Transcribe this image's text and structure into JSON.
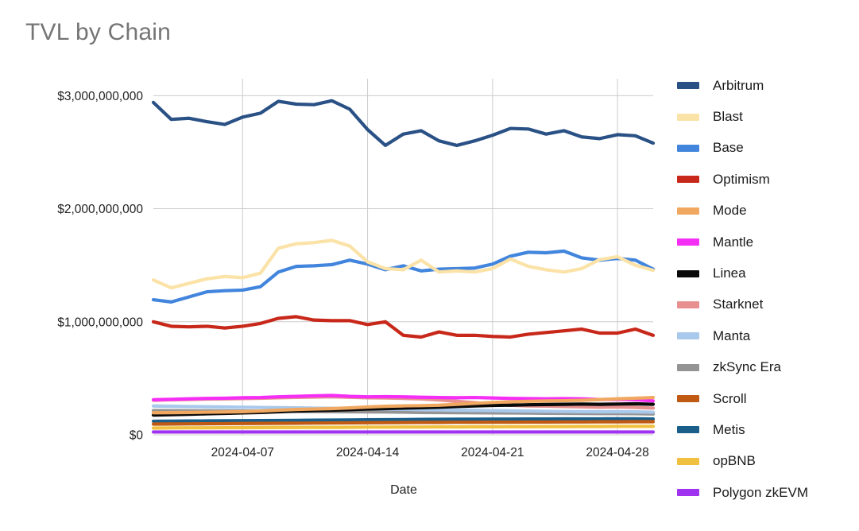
{
  "chart_data": {
    "type": "line",
    "title": "TVL by Chain",
    "xlabel": "Date",
    "ylabel": "",
    "grid": true,
    "legend_position": "right",
    "ylim": [
      0,
      3150000000
    ],
    "y_ticks": [
      0,
      1000000000,
      2000000000,
      3000000000
    ],
    "y_tick_labels": [
      "$0",
      "$1,000,000,000",
      "$2,000,000,000",
      "$3,000,000,000"
    ],
    "x_tick_labels": [
      "2024-04-07",
      "2024-04-14",
      "2024-04-21",
      "2024-04-28"
    ],
    "x_tick_indices": [
      5,
      12,
      19,
      26
    ],
    "x": [
      "2024-04-02",
      "2024-04-03",
      "2024-04-04",
      "2024-04-05",
      "2024-04-06",
      "2024-04-07",
      "2024-04-08",
      "2024-04-09",
      "2024-04-10",
      "2024-04-11",
      "2024-04-12",
      "2024-04-13",
      "2024-04-14",
      "2024-04-15",
      "2024-04-16",
      "2024-04-17",
      "2024-04-18",
      "2024-04-19",
      "2024-04-20",
      "2024-04-21",
      "2024-04-22",
      "2024-04-23",
      "2024-04-24",
      "2024-04-25",
      "2024-04-26",
      "2024-04-27",
      "2024-04-28",
      "2024-04-29",
      "2024-04-30"
    ],
    "series": [
      {
        "name": "Arbitrum",
        "color": "#2a5185",
        "values": [
          2940000000,
          2790000000,
          2800000000,
          2770000000,
          2745000000,
          2810000000,
          2845000000,
          2950000000,
          2925000000,
          2920000000,
          2955000000,
          2880000000,
          2700000000,
          2560000000,
          2660000000,
          2690000000,
          2600000000,
          2560000000,
          2600000000,
          2650000000,
          2710000000,
          2705000000,
          2660000000,
          2690000000,
          2635000000,
          2620000000,
          2655000000,
          2645000000,
          2580000000
        ]
      },
      {
        "name": "Blast",
        "color": "#fbe2a7",
        "values": [
          1370000000,
          1300000000,
          1340000000,
          1380000000,
          1400000000,
          1390000000,
          1430000000,
          1650000000,
          1690000000,
          1700000000,
          1720000000,
          1670000000,
          1530000000,
          1470000000,
          1460000000,
          1545000000,
          1440000000,
          1450000000,
          1440000000,
          1470000000,
          1555000000,
          1490000000,
          1460000000,
          1440000000,
          1470000000,
          1550000000,
          1575000000,
          1500000000,
          1455000000
        ]
      },
      {
        "name": "Base",
        "color": "#4285dd",
        "values": [
          1195000000,
          1175000000,
          1220000000,
          1265000000,
          1275000000,
          1280000000,
          1310000000,
          1440000000,
          1490000000,
          1495000000,
          1505000000,
          1545000000,
          1510000000,
          1460000000,
          1495000000,
          1450000000,
          1465000000,
          1470000000,
          1475000000,
          1510000000,
          1580000000,
          1615000000,
          1610000000,
          1625000000,
          1565000000,
          1545000000,
          1560000000,
          1545000000,
          1465000000
        ]
      },
      {
        "name": "Optimism",
        "color": "#c8281a",
        "values": [
          1000000000,
          960000000,
          955000000,
          960000000,
          945000000,
          960000000,
          985000000,
          1030000000,
          1045000000,
          1015000000,
          1010000000,
          1010000000,
          975000000,
          1000000000,
          880000000,
          865000000,
          910000000,
          880000000,
          880000000,
          870000000,
          865000000,
          890000000,
          905000000,
          920000000,
          935000000,
          900000000,
          900000000,
          935000000,
          880000000
        ]
      },
      {
        "name": "Mode",
        "color": "#f0a860",
        "values": [
          195000000,
          196000000,
          198000000,
          200000000,
          202000000,
          205000000,
          210000000,
          218000000,
          224000000,
          228000000,
          232000000,
          238000000,
          246000000,
          252000000,
          256000000,
          258000000,
          262000000,
          270000000,
          278000000,
          286000000,
          292000000,
          296000000,
          300000000,
          302000000,
          306000000,
          312000000,
          318000000,
          324000000,
          330000000
        ]
      },
      {
        "name": "Mantle",
        "color": "#f52ef5",
        "values": [
          310000000,
          314000000,
          318000000,
          322000000,
          324000000,
          328000000,
          330000000,
          336000000,
          340000000,
          345000000,
          348000000,
          340000000,
          336000000,
          338000000,
          336000000,
          332000000,
          330000000,
          328000000,
          330000000,
          326000000,
          322000000,
          320000000,
          318000000,
          320000000,
          318000000,
          312000000,
          314000000,
          310000000,
          300000000
        ]
      },
      {
        "name": "Linea",
        "color": "#0a0a0a",
        "values": [
          175000000,
          178000000,
          182000000,
          186000000,
          190000000,
          194000000,
          198000000,
          204000000,
          210000000,
          214000000,
          218000000,
          222000000,
          228000000,
          232000000,
          236000000,
          240000000,
          244000000,
          250000000,
          256000000,
          260000000,
          262000000,
          266000000,
          268000000,
          270000000,
          272000000,
          270000000,
          272000000,
          274000000,
          270000000
        ]
      },
      {
        "name": "Starknet",
        "color": "#e89090",
        "values": [
          306000000,
          310000000,
          313000000,
          316000000,
          318000000,
          321000000,
          323000000,
          328000000,
          331000000,
          334000000,
          336000000,
          332000000,
          328000000,
          326000000,
          322000000,
          318000000,
          308000000,
          296000000,
          284000000,
          272000000,
          262000000,
          256000000,
          254000000,
          250000000,
          248000000,
          244000000,
          246000000,
          242000000,
          236000000
        ]
      },
      {
        "name": "Manta",
        "color": "#a8c8ec",
        "values": [
          255000000,
          252000000,
          250000000,
          248000000,
          246000000,
          244000000,
          242000000,
          240000000,
          238000000,
          236000000,
          234000000,
          232000000,
          230000000,
          228000000,
          226000000,
          222000000,
          220000000,
          218000000,
          216000000,
          214000000,
          212000000,
          210000000,
          208000000,
          206000000,
          205000000,
          204000000,
          204000000,
          203000000,
          200000000
        ]
      },
      {
        "name": "zkSync Era",
        "color": "#949494",
        "values": [
          215000000,
          214000000,
          213000000,
          212000000,
          211000000,
          210000000,
          209000000,
          208000000,
          207000000,
          206000000,
          205000000,
          204000000,
          203000000,
          202000000,
          200000000,
          198000000,
          197000000,
          196000000,
          195000000,
          194000000,
          193000000,
          192000000,
          191000000,
          190000000,
          189000000,
          188000000,
          188000000,
          187000000,
          184000000
        ]
      },
      {
        "name": "Scroll",
        "color": "#c05a12",
        "values": [
          95000000,
          96000000,
          97000000,
          98000000,
          99000000,
          100000000,
          101000000,
          102000000,
          103000000,
          104000000,
          105000000,
          106000000,
          107000000,
          108000000,
          109000000,
          110000000,
          110000000,
          111000000,
          111000000,
          112000000,
          112000000,
          113000000,
          113000000,
          114000000,
          114000000,
          115000000,
          115000000,
          116000000,
          116000000
        ]
      },
      {
        "name": "Metis",
        "color": "#1a5f8a",
        "values": [
          120000000,
          121000000,
          122000000,
          123000000,
          124000000,
          125000000,
          126000000,
          127000000,
          128000000,
          129000000,
          130000000,
          131000000,
          133000000,
          134000000,
          135000000,
          136000000,
          137000000,
          138000000,
          138000000,
          139000000,
          139000000,
          140000000,
          140000000,
          141000000,
          141000000,
          141000000,
          142000000,
          142000000,
          140000000
        ]
      },
      {
        "name": "opBNB",
        "color": "#f0c040",
        "values": [
          60000000,
          61000000,
          62000000,
          62000000,
          63000000,
          63000000,
          64000000,
          65000000,
          65000000,
          66000000,
          66000000,
          67000000,
          68000000,
          68000000,
          69000000,
          69000000,
          70000000,
          70000000,
          71000000,
          71000000,
          72000000,
          72000000,
          73000000,
          73000000,
          74000000,
          74000000,
          75000000,
          75000000,
          75000000
        ]
      },
      {
        "name": "Polygon zkEVM",
        "color": "#a033f0",
        "values": [
          25000000,
          25000000,
          25000000,
          25000000,
          25000000,
          25000000,
          25000000,
          25000000,
          25000000,
          25000000,
          25000000,
          25000000,
          25000000,
          25000000,
          25000000,
          25000000,
          25000000,
          25000000,
          25000000,
          25000000,
          25000000,
          25000000,
          25000000,
          25000000,
          25000000,
          25000000,
          25000000,
          25000000,
          25000000
        ]
      }
    ]
  }
}
